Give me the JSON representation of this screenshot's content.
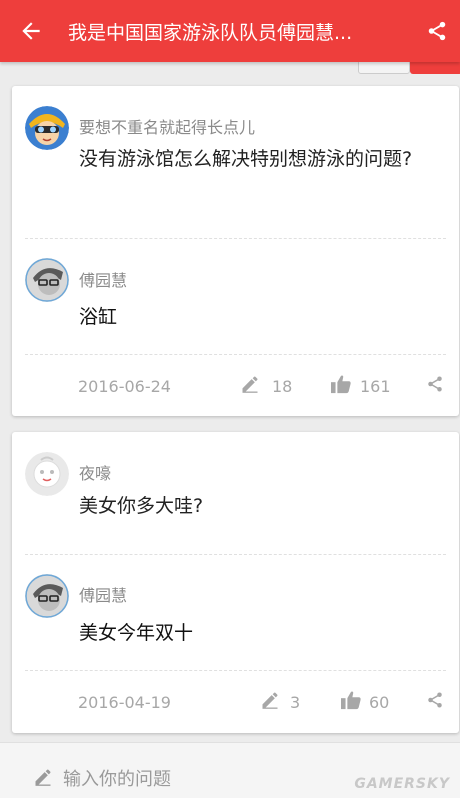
{
  "header": {
    "title": "我是中国国家游泳队队员傅园慧..."
  },
  "icons": {
    "back": "arrow-left-icon",
    "share": "share-icon",
    "answer": "pencil-icon",
    "like": "thumbs-up-icon"
  },
  "colors": {
    "brand": "#ee3e3c",
    "background": "#ececec"
  },
  "qa": [
    {
      "asker": "要想不重名就起得长点儿",
      "question": "没有游泳馆怎么解决特别想游泳的问题?",
      "answerer": "傅园慧",
      "answer": "浴缸",
      "date": "2016-06-24",
      "answers": "18",
      "likes": "161"
    },
    {
      "asker": "夜嚎",
      "question": "美女你多大哇?",
      "answerer": "傅园慧",
      "answer": "美女今年双十",
      "date": "2016-04-19",
      "answers": "3",
      "likes": "60"
    }
  ],
  "input": {
    "placeholder": "输入你的问题"
  },
  "watermark": "GAMERSKY"
}
